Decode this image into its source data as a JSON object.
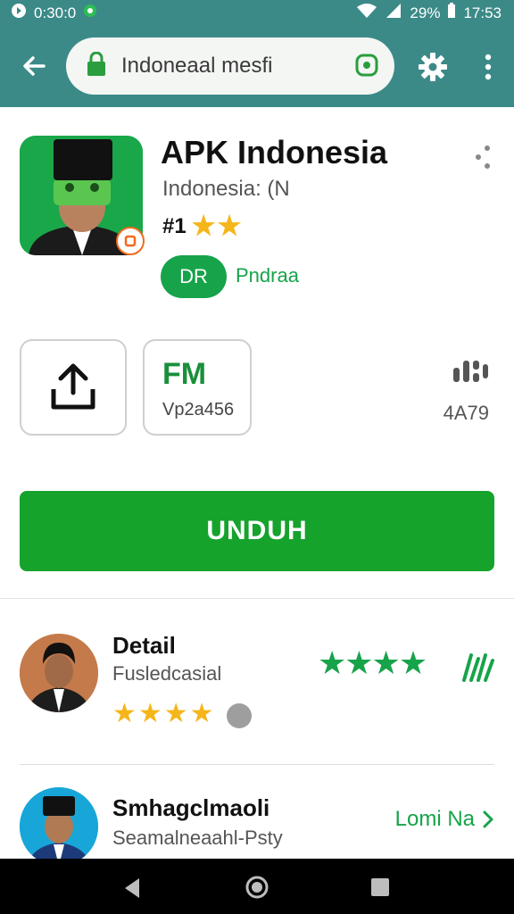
{
  "status": {
    "time_left": "0:30:0",
    "battery": "29%",
    "time_right": "17:53"
  },
  "toolbar": {
    "url": "Indoneaal mesfi"
  },
  "app": {
    "title": "APK Indonesia",
    "subtitle": "Indonesia: (N",
    "rank": "#1",
    "rank_stars": "★★",
    "pill": "DR",
    "pill_label": "Pndraa"
  },
  "actions": {
    "box2_big": "FM",
    "box2_small": "Vp2a456",
    "count": "4A79"
  },
  "download": {
    "label": "UNDUH"
  },
  "list": [
    {
      "title": "Detail",
      "subtitle": "Fusledcasial",
      "stars": "★★★★",
      "right_stars": "★★★★"
    },
    {
      "title": "Smhagclmaoli",
      "subtitle": "Seamalneaahl-Psty",
      "link": "Lomi Na"
    }
  ]
}
